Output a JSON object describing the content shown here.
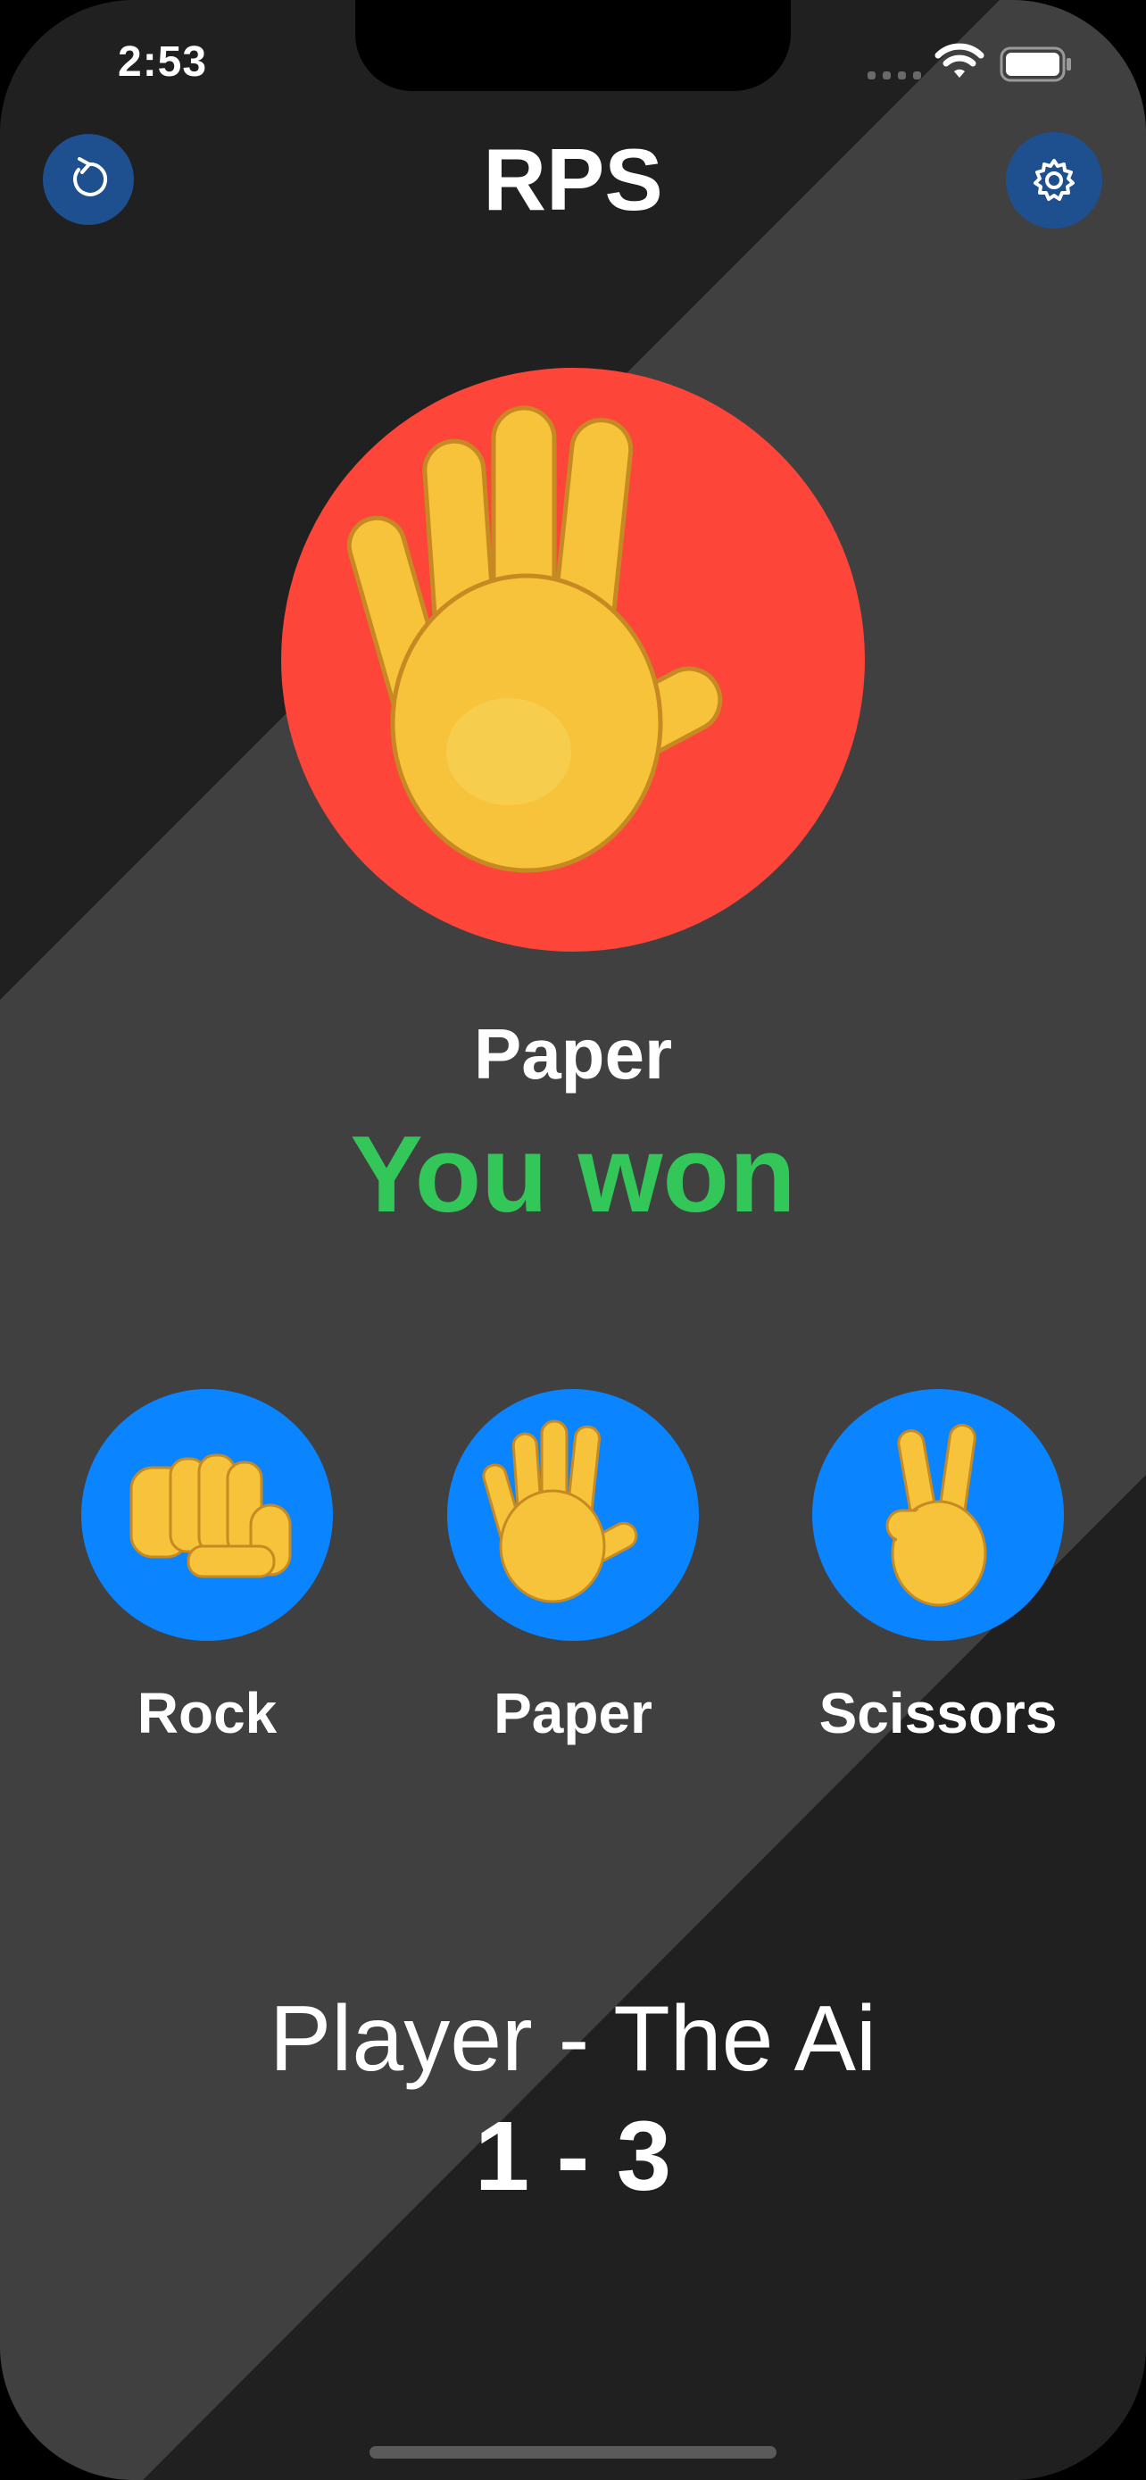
{
  "status_bar": {
    "time": "2:53"
  },
  "header": {
    "title": "RPS",
    "reset_icon": "reset-icon",
    "settings_icon": "gear-icon"
  },
  "ai": {
    "icon": "raised-hand-icon",
    "choice_label": "Paper",
    "result_text": "You won"
  },
  "choices": [
    {
      "label": "Rock",
      "icon": "fist-icon"
    },
    {
      "label": "Paper",
      "icon": "raised-hand-icon"
    },
    {
      "label": "Scissors",
      "icon": "victory-hand-icon"
    }
  ],
  "score": {
    "title": "Player - The Ai",
    "value": "1 - 3"
  },
  "colors": {
    "background_dark": "#202020",
    "background_stripe": "#404040",
    "ai_circle": "#fe453a",
    "choice_button": "#0a84ff",
    "top_button": "#1e4f8f",
    "win_text": "#33c759"
  }
}
